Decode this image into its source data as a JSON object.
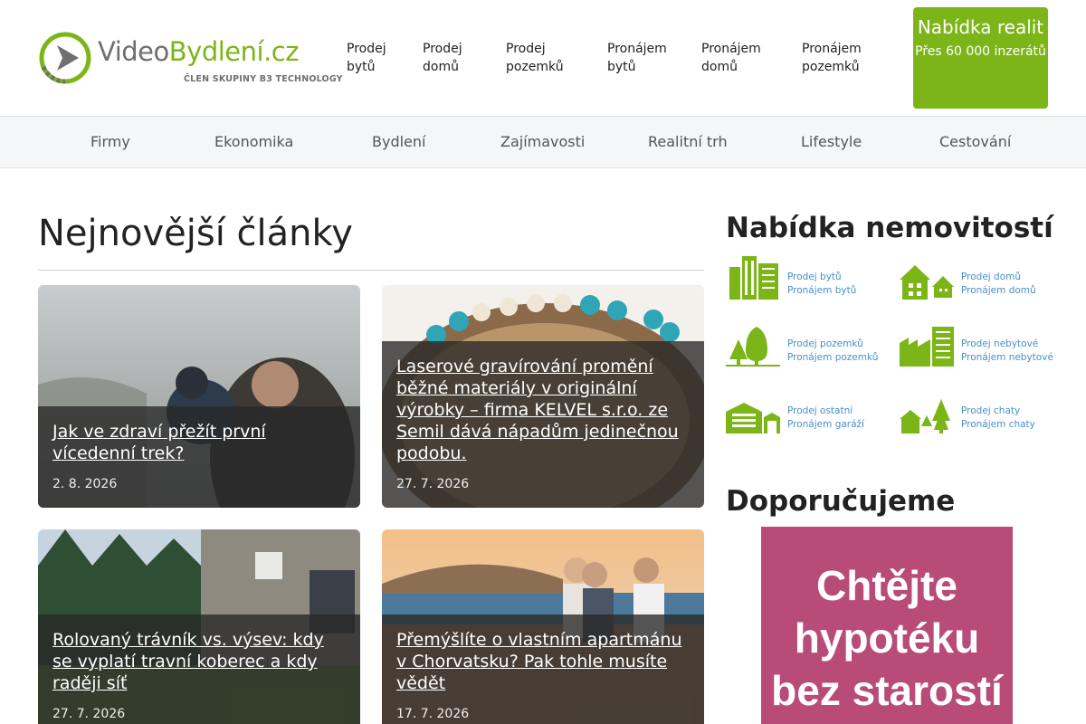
{
  "brand": {
    "logo_part1": "Video",
    "logo_part2": "Bydlení.cz",
    "tagline": "ČLEN SKUPINY B3 TECHNOLOGY",
    "accent_color": "#7cb518"
  },
  "top_nav": [
    {
      "label": "Prodej bytů"
    },
    {
      "label": "Prodej domů"
    },
    {
      "label": "Prodej pozemků"
    },
    {
      "label": "Pronájem bytů"
    },
    {
      "label": "Pronájem domů"
    },
    {
      "label": "Pronájem pozemků"
    }
  ],
  "cta": {
    "title": "Nabídka realit",
    "subtitle": "Přes 60 000 inzerátů"
  },
  "categories": [
    {
      "label": "Firmy"
    },
    {
      "label": "Ekonomika"
    },
    {
      "label": "Bydlení"
    },
    {
      "label": "Zajímavosti"
    },
    {
      "label": "Realitní trh"
    },
    {
      "label": "Lifestyle"
    },
    {
      "label": "Cestování"
    }
  ],
  "main": {
    "heading": "Nejnovější články",
    "articles": [
      {
        "title": "Jak ve zdraví přežít první vícedenní trek?",
        "date": "2. 8. 2026",
        "image": "father-and-child-in-fog"
      },
      {
        "title": "Laserové gravírování promění běžné materiály v originální výrobky – firma KELVEL s.r.o. ze Semil dává nápadům jedinečnou podobu.",
        "date": "27. 7. 2026",
        "image": "bead-bracelet-on-wood-slice"
      },
      {
        "title": "Rolovaný trávník vs. výsev: kdy se vyplatí travní koberec a kdy raději síť",
        "date": "27. 7. 2026",
        "image": "lawn-and-house"
      },
      {
        "title": "Přemýšlíte o vlastním apartmánu v Chorvatsku? Pak tohle musíte vědět",
        "date": "17. 7. 2026",
        "image": "people-at-coastal-town"
      }
    ]
  },
  "sidebar": {
    "offers_heading": "Nabídka nemovitostí",
    "offers": [
      {
        "line1": "Prodej bytů",
        "line2": "Pronájem bytů",
        "icon": "apartment-buildings-icon"
      },
      {
        "line1": "Prodej domů",
        "line2": "Pronájem domů",
        "icon": "houses-icon"
      },
      {
        "line1": "Prodej pozemků",
        "line2": "Pronájem pozemků",
        "icon": "trees-land-icon"
      },
      {
        "line1": "Prodej nebytové",
        "line2": "Pronájem nebytové",
        "icon": "factory-building-icon"
      },
      {
        "line1": "Prodej ostatní",
        "line2": "Pronájem garáží",
        "icon": "garage-icon"
      },
      {
        "line1": "Prodej chaty",
        "line2": "Pronájem chaty",
        "icon": "cottage-trees-icon"
      }
    ],
    "recommend_heading": "Doporučujeme",
    "ad": {
      "text": "Chtějte hypotéku bez starostí",
      "color": "#b94b79"
    }
  }
}
